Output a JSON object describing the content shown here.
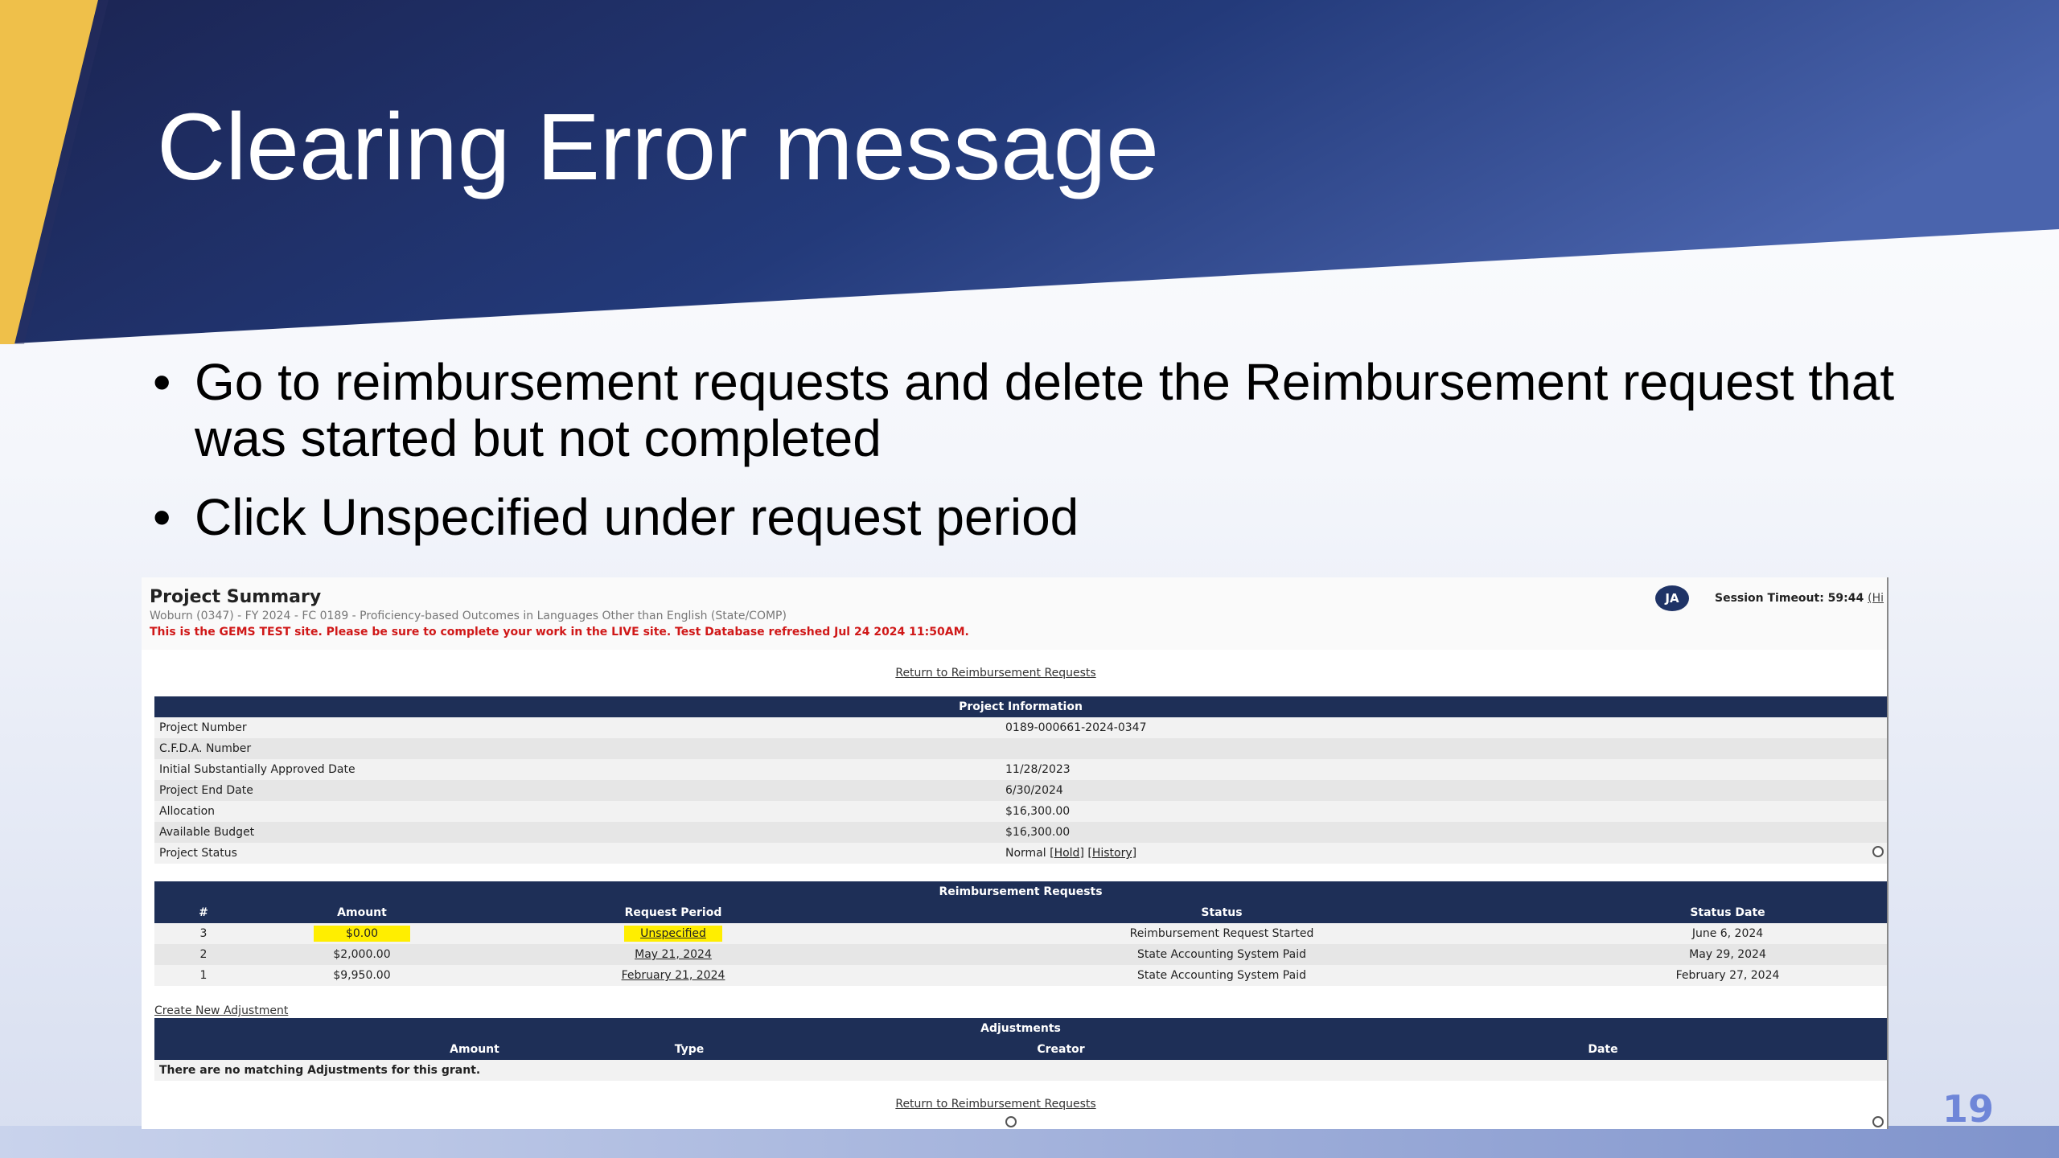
{
  "slide": {
    "title": "Clearing Error message",
    "bullets": [
      "Go to reimbursement requests and delete the Reimbursement request that was started but not completed",
      "Click Unspecified under request period"
    ],
    "bullet_glyph": "•",
    "page_number": "19",
    "colors": {
      "banner": "#1e2c5e",
      "accent": "#f0c040",
      "page_number": "#6f86d8"
    }
  },
  "screenshot": {
    "header": {
      "title": "Project Summary",
      "subtitle": "Woburn (0347) - FY 2024 - FC 0189 - Proficiency-based Outcomes in Languages Other than English (State/COMP)",
      "warning": "This is the GEMS TEST site. Please be sure to complete your work in the LIVE site. Test Database refreshed Jul 24 2024 11:50AM.",
      "avatar": "JA",
      "session_label": "Session Timeout: 59:44",
      "session_link": "(Hi"
    },
    "return_link": "Return to Reimbursement Requests",
    "project_info": {
      "caption": "Project Information",
      "rows": [
        {
          "label": "Project Number",
          "value": "0189-000661-2024-0347"
        },
        {
          "label": "C.F.D.A. Number",
          "value": ""
        },
        {
          "label": "Initial Substantially Approved Date",
          "value": "11/28/2023"
        },
        {
          "label": "Project End Date",
          "value": "6/30/2024"
        },
        {
          "label": "Allocation",
          "value": "$16,300.00"
        },
        {
          "label": "Available Budget",
          "value": "$16,300.00"
        }
      ],
      "status_label": "Project Status",
      "status_value": "Normal",
      "status_hold": "[Hold]",
      "status_history": "[History]"
    },
    "reimbursement_requests": {
      "caption": "Reimbursement Requests",
      "columns": [
        "#",
        "Amount",
        "Request Period",
        "Status",
        "Status Date"
      ],
      "rows": [
        {
          "num": "3",
          "amount": "$0.00",
          "period": "Unspecified",
          "status": "Reimbursement Request Started",
          "date": "June 6, 2024"
        },
        {
          "num": "2",
          "amount": "$2,000.00",
          "period": "May 21, 2024",
          "status": "State Accounting System Paid",
          "date": "May 29, 2024"
        },
        {
          "num": "1",
          "amount": "$9,950.00",
          "period": "February 21, 2024",
          "status": "State Accounting System Paid",
          "date": "February 27, 2024"
        }
      ]
    },
    "create_adjustment_link": "Create New Adjustment",
    "adjustments": {
      "caption": "Adjustments",
      "columns": [
        "Amount",
        "Type",
        "Creator",
        "Date"
      ],
      "empty_message": "There are no matching Adjustments for this grant."
    }
  }
}
